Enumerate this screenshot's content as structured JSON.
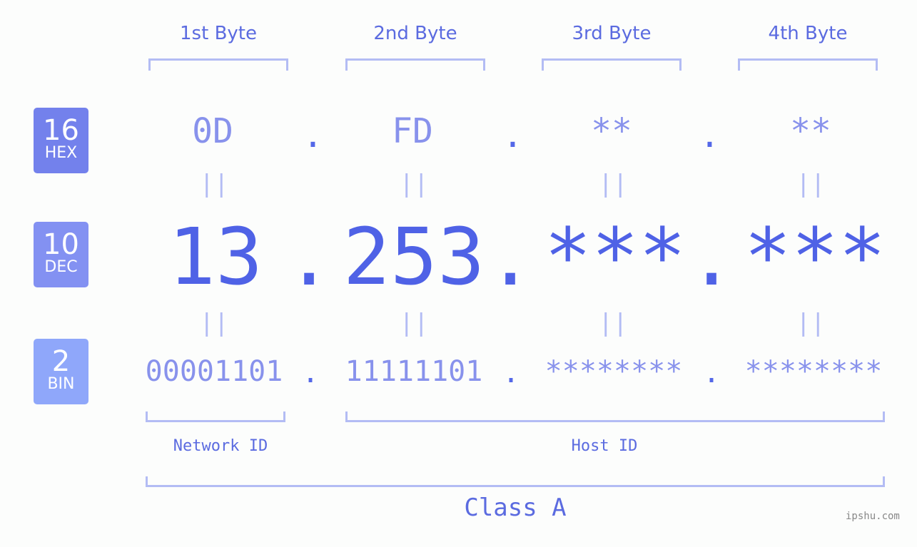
{
  "badges": [
    {
      "num": "16",
      "label": "HEX",
      "color": "#7381ec"
    },
    {
      "num": "10",
      "label": "DEC",
      "color": "#8391f2"
    },
    {
      "num": "2",
      "label": "BIN",
      "color": "#8fa7fa"
    }
  ],
  "byte_headers": [
    "1st Byte",
    "2nd Byte",
    "3rd Byte",
    "4th Byte"
  ],
  "hex": [
    "0D",
    "FD",
    "**",
    "**"
  ],
  "dec": [
    "13",
    "253",
    "***",
    "***"
  ],
  "bin": [
    "00001101",
    "11111101",
    "********",
    "********"
  ],
  "separator": ".",
  "equals": "||",
  "network_label": "Network ID",
  "host_label": "Host ID",
  "class_label": "Class A",
  "watermark": "ipshu.com"
}
